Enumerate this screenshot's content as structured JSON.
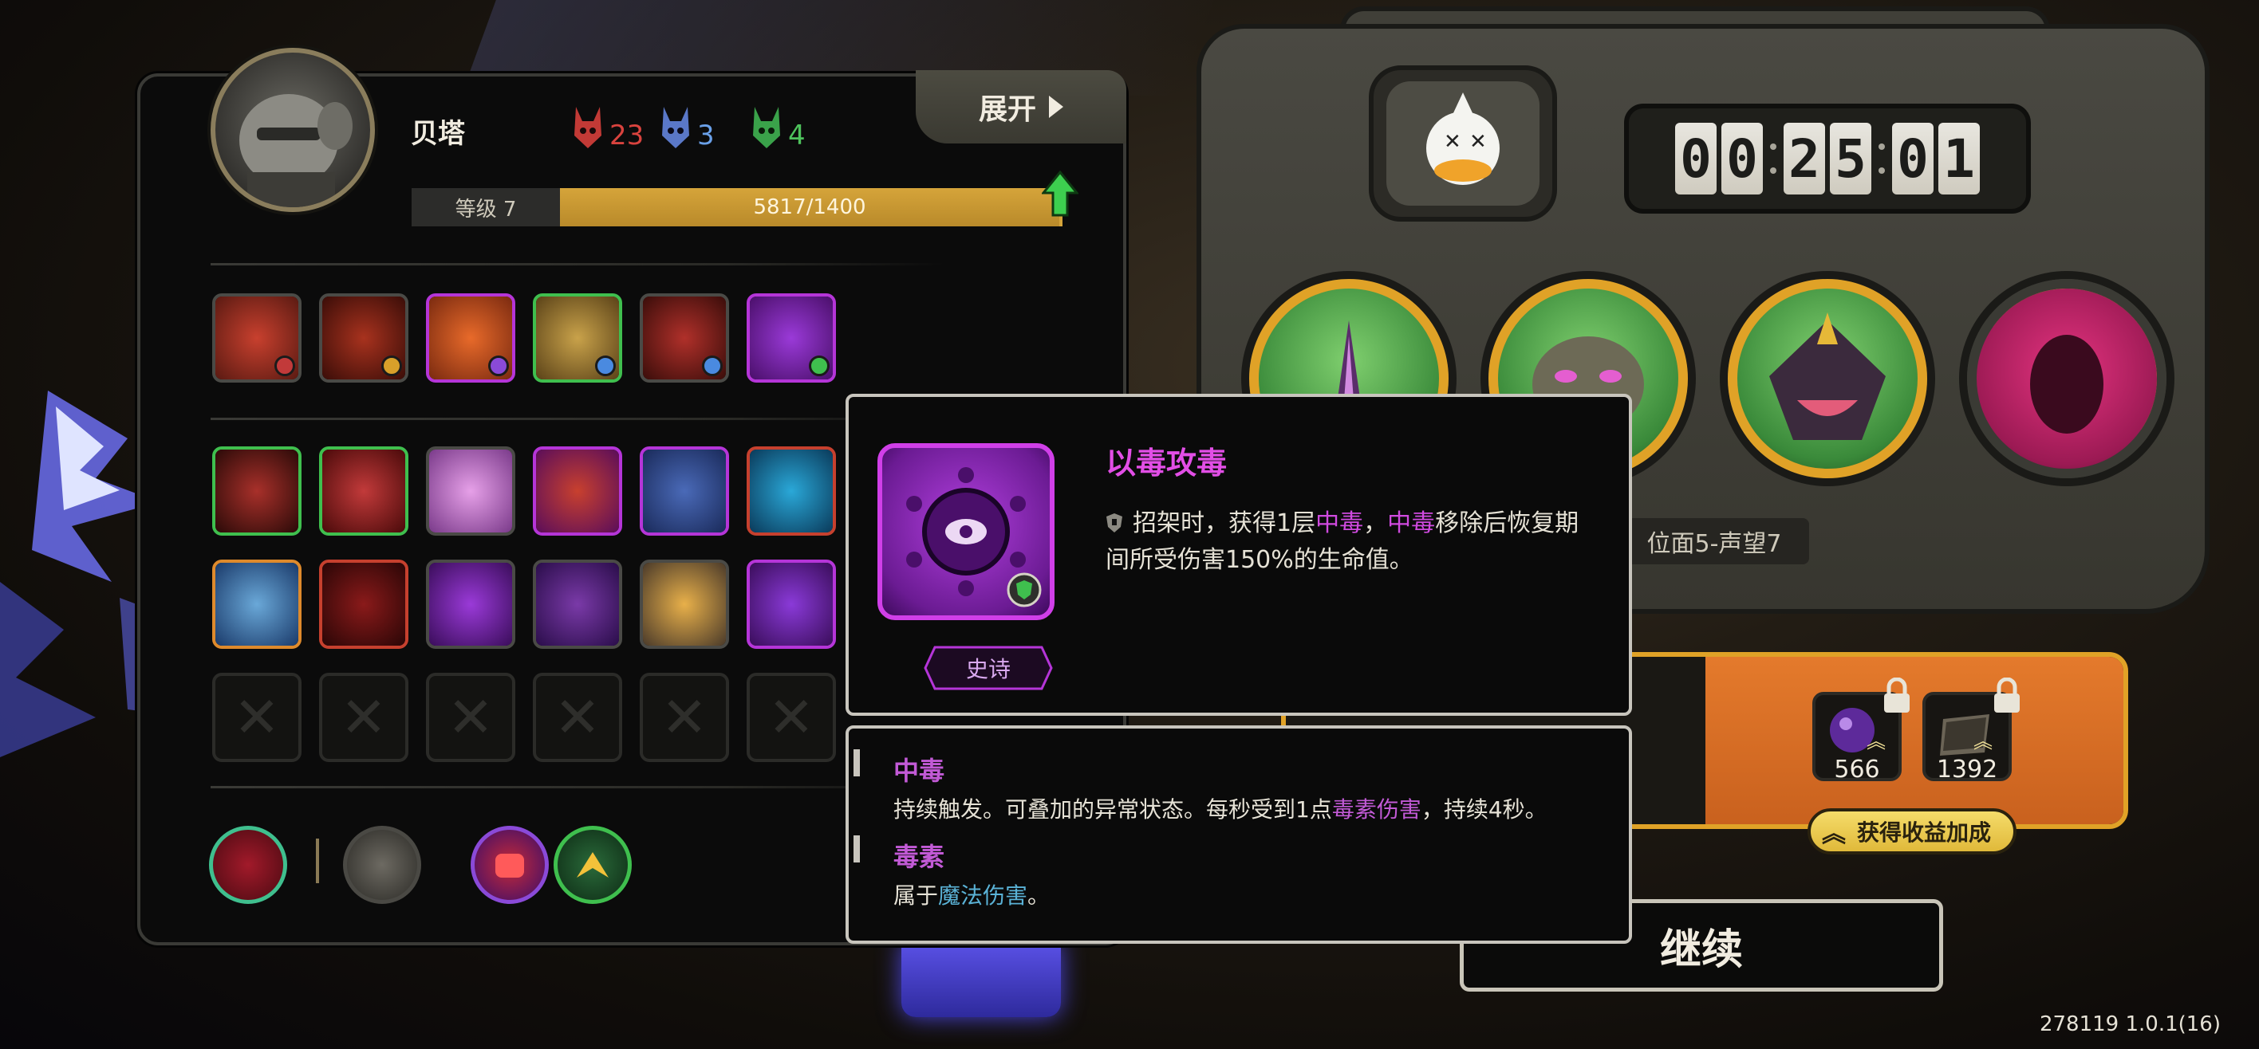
{
  "character": {
    "name": "贝塔",
    "stats": {
      "red": "23",
      "blue": "3",
      "green": "4"
    },
    "level_label": "等级 7",
    "xp_text": "5817/1400",
    "xp_fraction": 1.0
  },
  "expand_label": "展开",
  "skill_rows": {
    "row1": [
      {
        "name": "skill-claw-slash",
        "rarity": "gray",
        "badge": "red"
      },
      {
        "name": "skill-fire-demon",
        "rarity": "gray",
        "badge": "orange"
      },
      {
        "name": "skill-fire-streak",
        "rarity": "purple",
        "badge": "purple"
      },
      {
        "name": "skill-golden-totem",
        "rarity": "green",
        "badge": "blue"
      },
      {
        "name": "skill-winged-blade",
        "rarity": "gray",
        "badge": "blue"
      },
      {
        "name": "skill-poison-eye",
        "rarity": "purple",
        "badge": "green"
      }
    ],
    "row2": [
      {
        "name": "skill-blade-strike",
        "rarity": "green"
      },
      {
        "name": "skill-red-wings",
        "rarity": "green"
      },
      {
        "name": "skill-pink-crystal",
        "rarity": "gray"
      },
      {
        "name": "skill-lightning-rush",
        "rarity": "purple"
      },
      {
        "name": "skill-ice-shell",
        "rarity": "purple"
      },
      {
        "name": "skill-blue-star",
        "rarity": "red"
      }
    ],
    "row3": [
      {
        "name": "skill-ice-sword",
        "rarity": "orange"
      },
      {
        "name": "skill-red-gears",
        "rarity": "red"
      },
      {
        "name": "skill-purple-ghost",
        "rarity": "gray"
      },
      {
        "name": "skill-purple-claw",
        "rarity": "gray"
      },
      {
        "name": "skill-sunrise",
        "rarity": "gray"
      },
      {
        "name": "skill-thunder-cage",
        "rarity": "purple"
      }
    ],
    "empty_count": 6
  },
  "timer": {
    "digits": [
      "0",
      "0",
      "2",
      "5",
      "0",
      "1"
    ]
  },
  "plane_label": "位面5-声望7",
  "rewards": [
    {
      "value": "566"
    },
    {
      "value": "1392"
    }
  ],
  "bonus_label": "获得收益加成",
  "continue_label": "继续",
  "version": "278119 1.0.1(16)",
  "tooltip": {
    "title": "以毒攻毒",
    "desc_a": "招架时，获得1层",
    "desc_hl1": "中毒",
    "desc_b": "，",
    "desc_hl2": "中毒",
    "desc_c": "移除后恢复期间所受伤害150%的生命值。",
    "rarity": "史诗"
  },
  "glossary": [
    {
      "title": "中毒",
      "text_a": "持续触发。可叠加的异常状态。每秒受到1点",
      "text_hl": "毒素伤害",
      "text_b": "，持续4秒。"
    },
    {
      "title": "毒素",
      "text_a": "属于",
      "text_hl": "魔法伤害",
      "text_b": "。"
    }
  ],
  "colors": {
    "gold": "#e0a227",
    "epic": "#d03fe8",
    "poison": "#c25ad6",
    "magic": "#5ab2d6"
  }
}
